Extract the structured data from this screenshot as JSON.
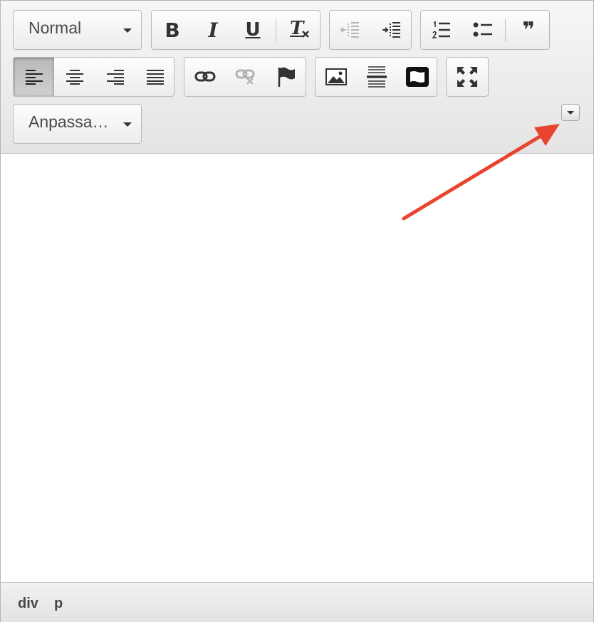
{
  "toolbar": {
    "format_combo": {
      "label": "Normal"
    },
    "styles_combo": {
      "label": "Anpassa…"
    },
    "basic_styles": {
      "bold": "B",
      "italic": "I",
      "underline": "U",
      "remove_format": "T"
    },
    "quote_glyph": "❞"
  },
  "elements_path": [
    "div",
    "p"
  ],
  "colors": {
    "annotation_arrow": "#e8442f",
    "toolbar_bg": "#e9e9e9"
  }
}
